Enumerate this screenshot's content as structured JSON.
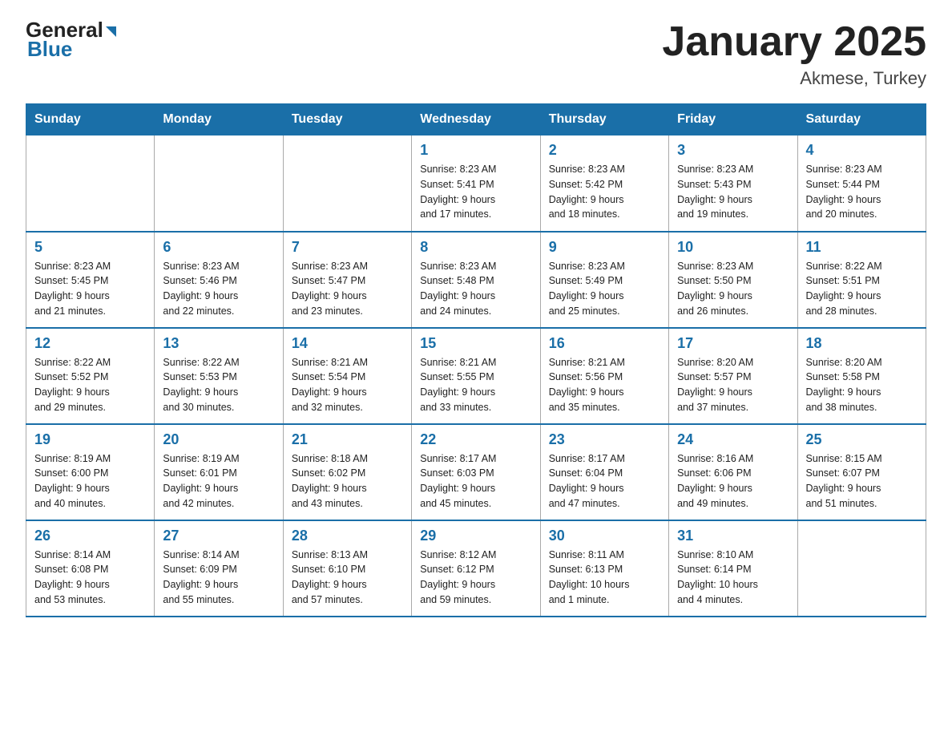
{
  "header": {
    "logo": {
      "line1": "General",
      "line2": "Blue"
    },
    "title": "January 2025",
    "subtitle": "Akmese, Turkey"
  },
  "weekdays": [
    "Sunday",
    "Monday",
    "Tuesday",
    "Wednesday",
    "Thursday",
    "Friday",
    "Saturday"
  ],
  "weeks": [
    [
      {
        "day": "",
        "info": ""
      },
      {
        "day": "",
        "info": ""
      },
      {
        "day": "",
        "info": ""
      },
      {
        "day": "1",
        "info": "Sunrise: 8:23 AM\nSunset: 5:41 PM\nDaylight: 9 hours\nand 17 minutes."
      },
      {
        "day": "2",
        "info": "Sunrise: 8:23 AM\nSunset: 5:42 PM\nDaylight: 9 hours\nand 18 minutes."
      },
      {
        "day": "3",
        "info": "Sunrise: 8:23 AM\nSunset: 5:43 PM\nDaylight: 9 hours\nand 19 minutes."
      },
      {
        "day": "4",
        "info": "Sunrise: 8:23 AM\nSunset: 5:44 PM\nDaylight: 9 hours\nand 20 minutes."
      }
    ],
    [
      {
        "day": "5",
        "info": "Sunrise: 8:23 AM\nSunset: 5:45 PM\nDaylight: 9 hours\nand 21 minutes."
      },
      {
        "day": "6",
        "info": "Sunrise: 8:23 AM\nSunset: 5:46 PM\nDaylight: 9 hours\nand 22 minutes."
      },
      {
        "day": "7",
        "info": "Sunrise: 8:23 AM\nSunset: 5:47 PM\nDaylight: 9 hours\nand 23 minutes."
      },
      {
        "day": "8",
        "info": "Sunrise: 8:23 AM\nSunset: 5:48 PM\nDaylight: 9 hours\nand 24 minutes."
      },
      {
        "day": "9",
        "info": "Sunrise: 8:23 AM\nSunset: 5:49 PM\nDaylight: 9 hours\nand 25 minutes."
      },
      {
        "day": "10",
        "info": "Sunrise: 8:23 AM\nSunset: 5:50 PM\nDaylight: 9 hours\nand 26 minutes."
      },
      {
        "day": "11",
        "info": "Sunrise: 8:22 AM\nSunset: 5:51 PM\nDaylight: 9 hours\nand 28 minutes."
      }
    ],
    [
      {
        "day": "12",
        "info": "Sunrise: 8:22 AM\nSunset: 5:52 PM\nDaylight: 9 hours\nand 29 minutes."
      },
      {
        "day": "13",
        "info": "Sunrise: 8:22 AM\nSunset: 5:53 PM\nDaylight: 9 hours\nand 30 minutes."
      },
      {
        "day": "14",
        "info": "Sunrise: 8:21 AM\nSunset: 5:54 PM\nDaylight: 9 hours\nand 32 minutes."
      },
      {
        "day": "15",
        "info": "Sunrise: 8:21 AM\nSunset: 5:55 PM\nDaylight: 9 hours\nand 33 minutes."
      },
      {
        "day": "16",
        "info": "Sunrise: 8:21 AM\nSunset: 5:56 PM\nDaylight: 9 hours\nand 35 minutes."
      },
      {
        "day": "17",
        "info": "Sunrise: 8:20 AM\nSunset: 5:57 PM\nDaylight: 9 hours\nand 37 minutes."
      },
      {
        "day": "18",
        "info": "Sunrise: 8:20 AM\nSunset: 5:58 PM\nDaylight: 9 hours\nand 38 minutes."
      }
    ],
    [
      {
        "day": "19",
        "info": "Sunrise: 8:19 AM\nSunset: 6:00 PM\nDaylight: 9 hours\nand 40 minutes."
      },
      {
        "day": "20",
        "info": "Sunrise: 8:19 AM\nSunset: 6:01 PM\nDaylight: 9 hours\nand 42 minutes."
      },
      {
        "day": "21",
        "info": "Sunrise: 8:18 AM\nSunset: 6:02 PM\nDaylight: 9 hours\nand 43 minutes."
      },
      {
        "day": "22",
        "info": "Sunrise: 8:17 AM\nSunset: 6:03 PM\nDaylight: 9 hours\nand 45 minutes."
      },
      {
        "day": "23",
        "info": "Sunrise: 8:17 AM\nSunset: 6:04 PM\nDaylight: 9 hours\nand 47 minutes."
      },
      {
        "day": "24",
        "info": "Sunrise: 8:16 AM\nSunset: 6:06 PM\nDaylight: 9 hours\nand 49 minutes."
      },
      {
        "day": "25",
        "info": "Sunrise: 8:15 AM\nSunset: 6:07 PM\nDaylight: 9 hours\nand 51 minutes."
      }
    ],
    [
      {
        "day": "26",
        "info": "Sunrise: 8:14 AM\nSunset: 6:08 PM\nDaylight: 9 hours\nand 53 minutes."
      },
      {
        "day": "27",
        "info": "Sunrise: 8:14 AM\nSunset: 6:09 PM\nDaylight: 9 hours\nand 55 minutes."
      },
      {
        "day": "28",
        "info": "Sunrise: 8:13 AM\nSunset: 6:10 PM\nDaylight: 9 hours\nand 57 minutes."
      },
      {
        "day": "29",
        "info": "Sunrise: 8:12 AM\nSunset: 6:12 PM\nDaylight: 9 hours\nand 59 minutes."
      },
      {
        "day": "30",
        "info": "Sunrise: 8:11 AM\nSunset: 6:13 PM\nDaylight: 10 hours\nand 1 minute."
      },
      {
        "day": "31",
        "info": "Sunrise: 8:10 AM\nSunset: 6:14 PM\nDaylight: 10 hours\nand 4 minutes."
      },
      {
        "day": "",
        "info": ""
      }
    ]
  ]
}
